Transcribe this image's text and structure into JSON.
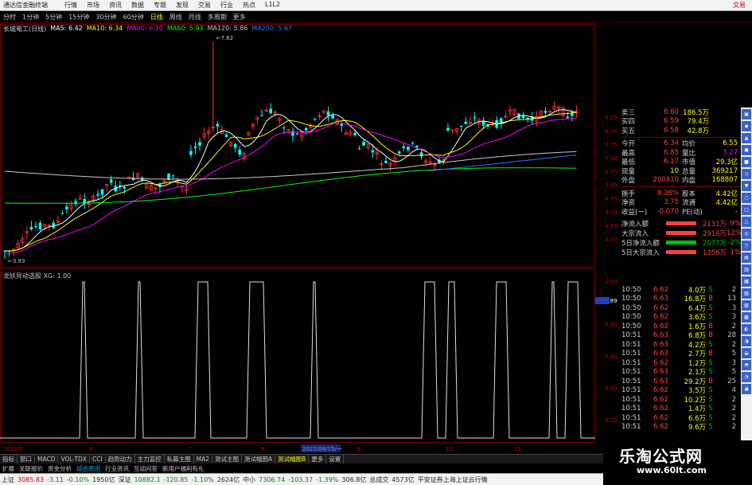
{
  "window": {
    "app_title": "通达信金融终端",
    "menu": [
      "行情",
      "市场",
      "资讯",
      "数据",
      "专题",
      "发现",
      "交易",
      "行业",
      "热点",
      "L1L2"
    ],
    "brand": "文易"
  },
  "periods": [
    "分时",
    "1分钟",
    "5分钟",
    "15分钟",
    "30分钟",
    "60分钟",
    "日线",
    "周线",
    "月线",
    "多周期",
    "更多"
  ],
  "active_period": "日线",
  "stock": {
    "name": "长城电工(日线)",
    "ma_legend": [
      {
        "label": "MA5: 6.42",
        "color": "#ffffff"
      },
      {
        "label": "MA10: 6.34",
        "color": "#ffff00"
      },
      {
        "label": "MA20: 6.10",
        "color": "#ff00ff"
      },
      {
        "label": "MA60: 5.93",
        "color": "#00ff00"
      },
      {
        "label": "MA120: 5.86",
        "color": "#c8c8c8"
      },
      {
        "label": "MA250: 5.67",
        "color": "#3070ff"
      }
    ],
    "high_mark": "7.62",
    "low_mark": "3.93"
  },
  "indicator_legend": "龙妖异动选股 XG: 1.00",
  "price_axis": [
    "6.25",
    "6.00",
    "5.75",
    "5.50",
    "5.25",
    "5.00",
    "4.75",
    "4.50",
    "4.25",
    "4.00"
  ],
  "indicator_axis": [
    "1.00",
    "0.89",
    "0.80",
    "0.60",
    "0.40",
    "0.20"
  ],
  "indicator_value": "0.89",
  "order_book": [
    {
      "label": "卖三",
      "price": "6.60",
      "vol": "186.5万"
    },
    {
      "label": "买四",
      "price": "6.59",
      "vol": "79.4万"
    },
    {
      "label": "买五",
      "price": "6.58",
      "vol": "42.8万"
    }
  ],
  "quote_stats": [
    {
      "l1": "今开",
      "v1": "6.34",
      "l2": "均价",
      "v2": "6.55"
    },
    {
      "l1": "最高",
      "v1": "6.85",
      "l2": "量比",
      "v2": "3.27"
    },
    {
      "l1": "最低",
      "v1": "6.17",
      "l2": "市值",
      "v2": "29.3亿"
    },
    {
      "l1": "现量",
      "v1": "10",
      "l2": "总量",
      "v2": "369217"
    },
    {
      "l1": "外盘",
      "v1": "200410",
      "l2": "内盘",
      "v2": "168807"
    },
    {
      "l1": "换手",
      "v1": "8.36%",
      "l2": "股本",
      "v2": "4.42亿"
    },
    {
      "l1": "净资",
      "v1": "3.75",
      "l2": "流通",
      "v2": "4.42亿"
    },
    {
      "l1": "收益(一)",
      "v1": "-0.070",
      "l2": "PE(动)",
      "v2": "-"
    }
  ],
  "fund_flow": [
    {
      "label": "净流入额",
      "value": "2131万",
      "pct": "9%",
      "color": "#ff4040"
    },
    {
      "label": "大宗流入",
      "value": "2916万",
      "pct": "12%",
      "color": "#ff4040"
    },
    {
      "label": "5日净流入额",
      "value": "2077万",
      "pct": "-2%",
      "color": "#00c000"
    },
    {
      "label": "5日大宗流入",
      "value": "1356万",
      "pct": "1%",
      "color": "#ff4040"
    }
  ],
  "trades": [
    {
      "time": "10:50",
      "price": "6.62",
      "vol": "4.0万",
      "bs": "S",
      "n": "2"
    },
    {
      "time": "10:50",
      "price": "6.63",
      "vol": "16.8万",
      "bs": "B",
      "n": "13"
    },
    {
      "time": "10:50",
      "price": "6.62",
      "vol": "6.4万",
      "bs": "S",
      "n": "3"
    },
    {
      "time": "10:50",
      "price": "6.62",
      "vol": "3.6万",
      "bs": "S",
      "n": "3"
    },
    {
      "time": "10:50",
      "price": "6.62",
      "vol": "1.6万",
      "bs": "B",
      "n": "2"
    },
    {
      "time": "10:51",
      "price": "6.63",
      "vol": "6.8万",
      "bs": "B",
      "n": "28"
    },
    {
      "time": "10:51",
      "price": "6.63",
      "vol": "4.2万",
      "bs": "S",
      "n": "2"
    },
    {
      "time": "10:51",
      "price": "6.63",
      "vol": "2.7万",
      "bs": "B",
      "n": "5"
    },
    {
      "time": "10:51",
      "price": "6.62",
      "vol": "1.2万",
      "bs": "S",
      "n": "3"
    },
    {
      "time": "10:51",
      "price": "6.63",
      "vol": "2.1万",
      "bs": "S",
      "n": "5"
    },
    {
      "time": "10:51",
      "price": "6.63",
      "vol": "29.2万",
      "bs": "B",
      "n": "25"
    },
    {
      "time": "10:51",
      "price": "6.62",
      "vol": "3.5万",
      "bs": "S",
      "n": "4"
    },
    {
      "time": "10:51",
      "price": "6.62",
      "vol": "10.2万",
      "bs": "S",
      "n": "2"
    },
    {
      "time": "10:51",
      "price": "6.62",
      "vol": "1.4万",
      "bs": "S",
      "n": "2"
    },
    {
      "time": "10:51",
      "price": "6.62",
      "vol": "6.6万",
      "bs": "S",
      "n": "2"
    },
    {
      "time": "10:51",
      "price": "6.62",
      "vol": "9.6万",
      "bs": "S",
      "n": "2"
    }
  ],
  "date_axis": [
    "2022年",
    "8",
    "7",
    "8",
    "2022/08/15/一",
    "9",
    "10",
    "11"
  ],
  "tabs": [
    "指标",
    "窗口",
    "MACD",
    "VOL-TDX",
    "CCI",
    "趋势动力",
    "主力监控",
    "私募主图",
    "MA2",
    "测试主图",
    "测试幅图A",
    "测试幅图B",
    "更多",
    "设置"
  ],
  "subtabs": [
    "扩展",
    "关联报价",
    "资金分析",
    "综合资讯",
    "行业资讯",
    "互动问答",
    "新用户福利有礼"
  ],
  "status": [
    {
      "name": "上证",
      "value": "3085.83",
      "chg": "-3.11",
      "pct": "-0.10%",
      "amt": "1950亿"
    },
    {
      "name": "深证",
      "value": "10882.1",
      "chg": "-120.85",
      "pct": "-1.10%",
      "amt": "2624亿"
    },
    {
      "name": "中小",
      "value": "7306.74",
      "chg": "-103.37",
      "pct": "-1.39%",
      "amt": "306.8亿"
    }
  ],
  "status_extra": {
    "label": "总成交",
    "value": "4573亿",
    "broker": "平安证券上海上证云行情"
  },
  "watermark": {
    "cn": "乐淘公式网",
    "url": "www.60lt.com"
  },
  "colors": {
    "up": "#ff3030",
    "down": "#00ffff",
    "bg": "#000000"
  }
}
